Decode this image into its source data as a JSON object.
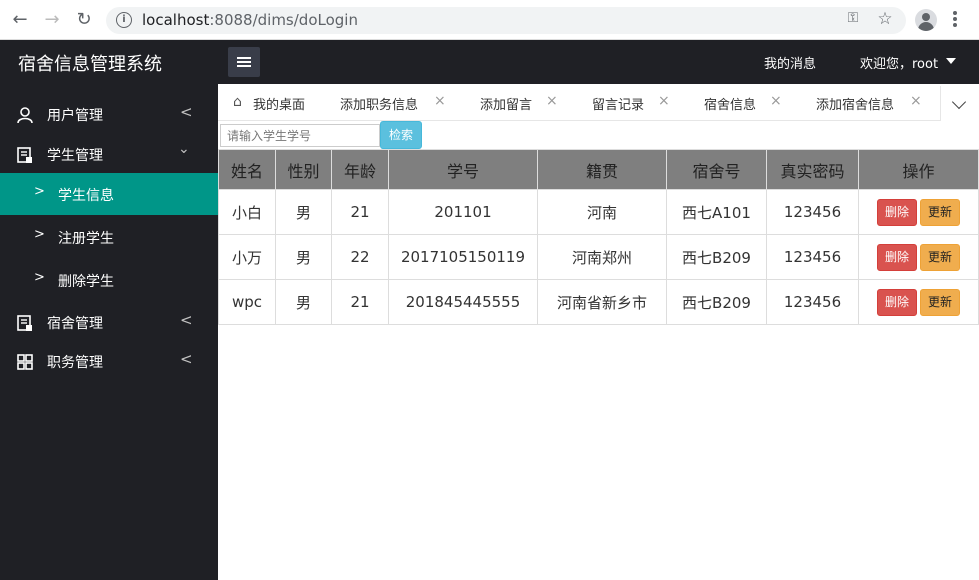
{
  "browser": {
    "url_host": "localhost",
    "url_rest": ":8088/dims/doLogin"
  },
  "header": {
    "title": "宿舍信息管理系统",
    "messages_label": "我的消息",
    "user_label": "欢迎您，root"
  },
  "sidebar": {
    "items": [
      {
        "label": "用户管理",
        "icon": "user-icon"
      },
      {
        "label": "学生管理",
        "icon": "document-icon"
      },
      {
        "label": "宿舍管理",
        "icon": "document-icon"
      },
      {
        "label": "职务管理",
        "icon": "grid-icon"
      }
    ],
    "subitems": [
      {
        "label": "学生信息",
        "active": true
      },
      {
        "label": "注册学生"
      },
      {
        "label": "删除学生"
      }
    ]
  },
  "tabs": [
    {
      "label": "我的桌面",
      "icon": "home-icon"
    },
    {
      "label": "添加职务信息"
    },
    {
      "label": "添加留言"
    },
    {
      "label": "留言记录"
    },
    {
      "label": "宿舍信息"
    },
    {
      "label": "添加宿舍信息"
    }
  ],
  "search": {
    "placeholder": "请输入学生学号",
    "button_label": "检索"
  },
  "table": {
    "headers": [
      "姓名",
      "性别",
      "年龄",
      "学号",
      "籍贯",
      "宿舍号",
      "真实密码",
      "操作"
    ],
    "rows": [
      [
        "小白",
        "男",
        "21",
        "201101",
        "河南",
        "西七A101",
        "123456"
      ],
      [
        "小万",
        "男",
        "22",
        "2017105150119",
        "河南郑州",
        "西七B209",
        "123456"
      ],
      [
        "wpc",
        "男",
        "21",
        "201845445555",
        "河南省新乡市",
        "西七B209",
        "123456"
      ]
    ],
    "delete_label": "删除",
    "update_label": "更新"
  },
  "colors": {
    "sidebar_bg": "#1f2025",
    "active_item": "#009688",
    "delete_btn": "#d9534f",
    "update_btn": "#f0ad4e",
    "search_btn": "#5bc0de"
  }
}
